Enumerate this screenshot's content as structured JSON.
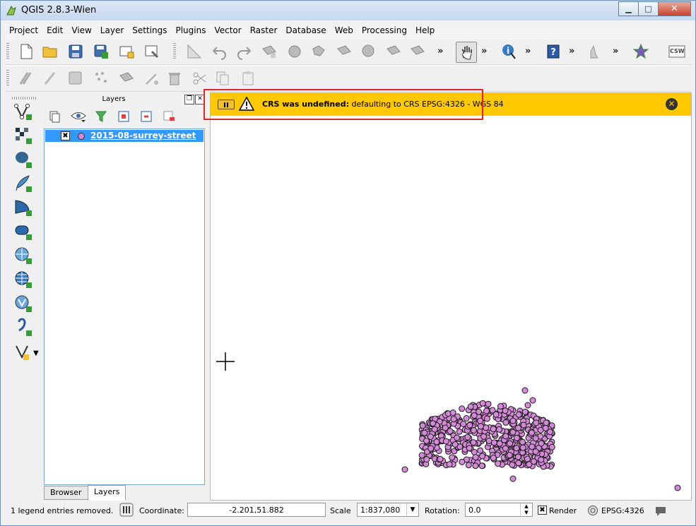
{
  "window": {
    "title": "QGIS 2.8.3-Wien",
    "buttons": {
      "minimize": "▁",
      "maximize": "□",
      "close": "✕"
    }
  },
  "menu": [
    "Project",
    "Edit",
    "View",
    "Layer",
    "Settings",
    "Plugins",
    "Vector",
    "Raster",
    "Database",
    "Web",
    "Processing",
    "Help"
  ],
  "toolbar": {
    "more": "»",
    "csw_label": "CSW"
  },
  "layers_panel": {
    "title": "Layers",
    "float_btn": "❐",
    "close_btn": "✕",
    "layers": [
      {
        "name": "2015-08-surrey-street",
        "checked": "✖"
      }
    ],
    "tabs": {
      "browser": "Browser",
      "layers": "Layers"
    }
  },
  "message_bar": {
    "bold": "CRS was undefined:",
    "text": " defaulting to CRS EPSG:4326 - WGS 84",
    "close": "✕"
  },
  "status_bar": {
    "message": "1 legend entries removed.",
    "coordinate_label": "Coordinate:",
    "coordinate_value": "-2.201,51.882",
    "scale_label": "Scale",
    "scale_value": "1:837,080",
    "rotation_label": "Rotation:",
    "rotation_value": "0.0",
    "render_label": "Render",
    "render_checked": "✖",
    "crs_label": "EPSG:4326"
  },
  "colors": {
    "point_fill": "#d58ad9",
    "point_stroke": "#1a1a1a",
    "message_bar": "#ffc800",
    "highlight": "#e0282c",
    "selection": "#3399ff"
  }
}
